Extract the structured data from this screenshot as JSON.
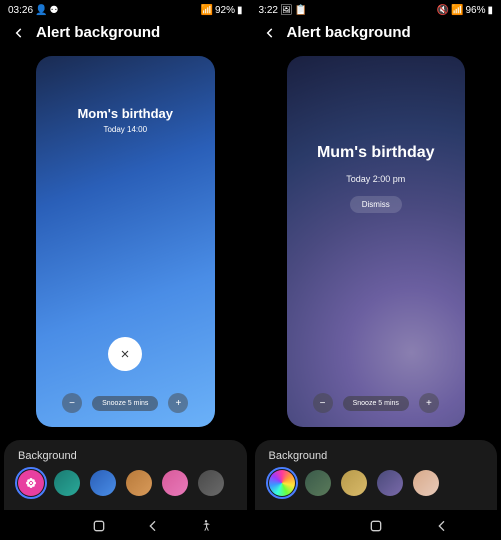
{
  "left": {
    "status": {
      "time": "03:26",
      "battery": "92%"
    },
    "header": {
      "title": "Alert background"
    },
    "preview": {
      "title": "Mom's birthday",
      "subtitle": "Today 14:00",
      "snooze": "Snooze 5 mins"
    },
    "bg_section": {
      "label": "Background"
    },
    "swatches": [
      {
        "style": "background:#e83fa0"
      },
      {
        "style": "background:linear-gradient(135deg,#1a7b72,#2aa898)"
      },
      {
        "style": "background:linear-gradient(135deg,#2a5fb8,#4a8de6)"
      },
      {
        "style": "background:linear-gradient(135deg,#b87a3a,#d89a5a)"
      },
      {
        "style": "background:linear-gradient(135deg,#d85a9a,#e87aba)"
      },
      {
        "style": "background:linear-gradient(135deg,#4a4a4a,#6a6a6a)"
      }
    ]
  },
  "right": {
    "status": {
      "time": "3:22",
      "battery": "96%"
    },
    "header": {
      "title": "Alert background"
    },
    "preview": {
      "title": "Mum's birthday",
      "subtitle": "Today 2:00 pm",
      "dismiss": "Dismiss",
      "snooze": "Snooze 5 mins"
    },
    "bg_section": {
      "label": "Background"
    },
    "swatches": [
      {
        "style": "background:conic-gradient(#ff3a9a,#ff9a3a,#ffe63a,#6aff3a,#3affda,#3a9aff,#9a3aff,#ff3a9a)"
      },
      {
        "style": "background:linear-gradient(135deg,#3a5a4a,#5a7a5a)"
      },
      {
        "style": "background:linear-gradient(135deg,#b89a4a,#d8ba6a)"
      },
      {
        "style": "background:linear-gradient(135deg,#4a4a7a,#7a6aaa)"
      },
      {
        "style": "background:linear-gradient(135deg,#d8aa8a,#e8caba)"
      },
      {
        "style": "background:linear-gradient(135deg,#aa9aaa,#cab aca)"
      }
    ]
  }
}
